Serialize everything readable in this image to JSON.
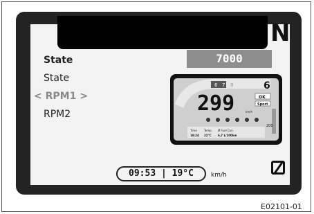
{
  "display": {
    "gear": "N",
    "menu": {
      "items": [
        {
          "label": "State",
          "style": "bold"
        },
        {
          "label": "State",
          "style": "normal"
        },
        {
          "label": "RPM1",
          "style": "selected",
          "arrow_left": "<",
          "arrow_right": ">"
        },
        {
          "label": "RPM2",
          "style": "normal"
        }
      ]
    },
    "value_box": "7000",
    "preview": {
      "gear": "6",
      "rpm_marks": [
        "6",
        "7",
        "8"
      ],
      "speed": "299",
      "speed_unit": "km/h",
      "mode_label": "Sport",
      "ok_label": "OK",
      "info_labels": [
        "Time",
        "Temp.",
        "Ø Fuel Con."
      ],
      "info_values": [
        "18:24",
        "22°C",
        "6,7 L/100km"
      ],
      "side_value": "200"
    },
    "status": {
      "time": "09:53",
      "temperature": "19°C",
      "speed_unit": "km/h"
    },
    "odo_icon": "odometer-reset-icon"
  },
  "caption": "E02101-01",
  "colors": {
    "device_body": "#232323",
    "screen_bg": "#f3f3f3",
    "value_box_bg": "#8d8d8d",
    "menu_selected": "#888888"
  }
}
